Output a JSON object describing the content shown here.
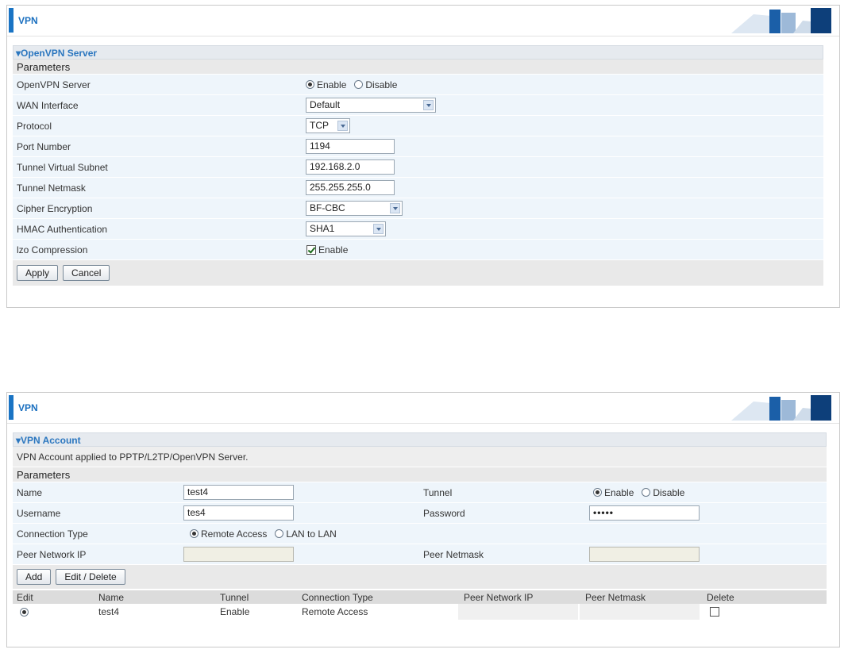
{
  "panel1": {
    "title": "VPN",
    "section_title": "OpenVPN Server",
    "params_header": "Parameters",
    "rows": {
      "server": {
        "label": "OpenVPN Server",
        "opt_enable": "Enable",
        "opt_disable": "Disable",
        "selected": "Enable"
      },
      "wan": {
        "label": "WAN Interface",
        "value": "Default"
      },
      "protocol": {
        "label": "Protocol",
        "value": "TCP"
      },
      "port": {
        "label": "Port Number",
        "value": "1194"
      },
      "subnet": {
        "label": "Tunnel Virtual Subnet",
        "value": "192.168.2.0"
      },
      "netmask": {
        "label": "Tunnel Netmask",
        "value": "255.255.255.0"
      },
      "cipher": {
        "label": "Cipher Encryption",
        "value": "BF-CBC"
      },
      "hmac": {
        "label": "HMAC Authentication",
        "value": "SHA1"
      },
      "lzo": {
        "label": "lzo Compression",
        "check_label": "Enable",
        "checked": true
      }
    },
    "buttons": {
      "apply": "Apply",
      "cancel": "Cancel"
    }
  },
  "panel2": {
    "title": "VPN",
    "section_title": "VPN Account",
    "note": "VPN Account applied to PPTP/L2TP/OpenVPN Server.",
    "params_header": "Parameters",
    "fields": {
      "name_label": "Name",
      "name_value": "test4",
      "tunnel_label": "Tunnel",
      "tunnel_enable": "Enable",
      "tunnel_disable": "Disable",
      "username_label": "Username",
      "username_value": "tes4",
      "password_label": "Password",
      "password_value": "•••••",
      "conn_label": "Connection Type",
      "conn_remote": "Remote Access",
      "conn_lan": "LAN to LAN",
      "peer_ip_label": "Peer Network IP",
      "peer_mask_label": "Peer Netmask"
    },
    "buttons": {
      "add": "Add",
      "edit_delete": "Edit / Delete"
    },
    "table": {
      "headers": [
        "Edit",
        "Name",
        "Tunnel",
        "Connection Type",
        "Peer Network IP",
        "Peer Netmask",
        "Delete"
      ],
      "rows": [
        {
          "name": "test4",
          "tunnel": "Enable",
          "connection_type": "Remote Access",
          "peer_ip": "",
          "peer_mask": ""
        }
      ]
    }
  }
}
